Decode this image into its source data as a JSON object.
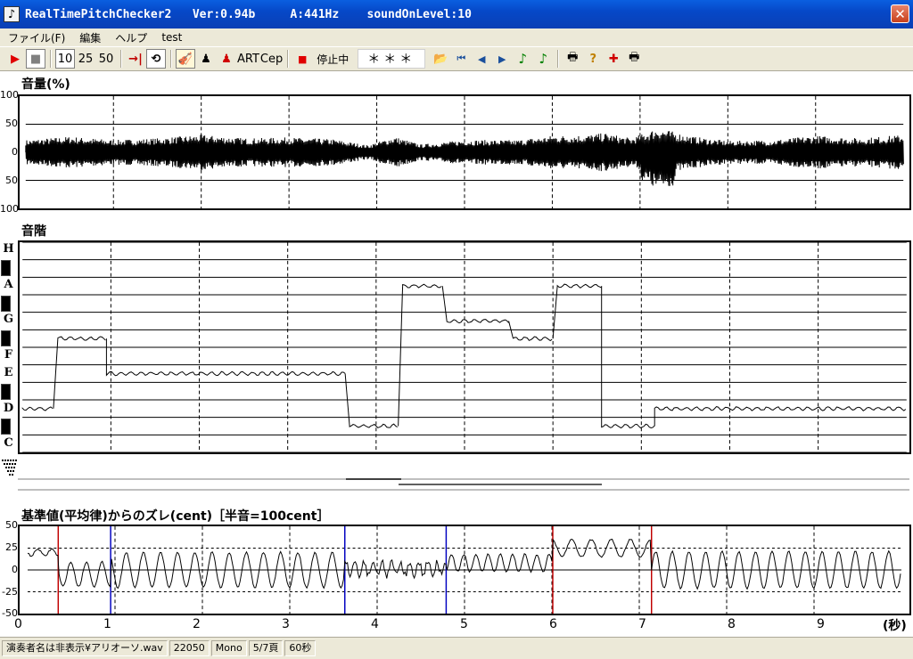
{
  "window": {
    "title": "RealTimePitchChecker2   Ver:0.94b     A:441Hz    soundOnLevel:10",
    "close_glyph": "✕",
    "app_icon_glyph": "♪"
  },
  "menu": [
    "ファイル(F)",
    "編集",
    "ヘルプ",
    "test"
  ],
  "toolbar": {
    "play_glyph": "▶",
    "stop_glyph": "■",
    "n10": "10",
    "n25": "25",
    "n50": "50",
    "to_end_glyph": "→|",
    "loop_glyph": "⟲",
    "violin_glyph": "🎻",
    "person_glyph": "♟",
    "person2_glyph": "♟",
    "art_label": "ART",
    "cep_label": "Cep",
    "rec_glyph": "■",
    "status_label": "停止中",
    "stars": "＊＊＊",
    "open_glyph": "📂",
    "first_glyph": "⏮",
    "prev_glyph": "◀",
    "next_glyph": "▶",
    "note1_glyph": "♪",
    "note2_glyph": "♪",
    "print_glyph": "🖶",
    "help_glyph": "?",
    "cross_glyph": "✚",
    "print2_glyph": "🖶",
    "colors": {
      "play": "#e00000",
      "note_green": "#008000",
      "rec": "#e00000"
    }
  },
  "volume_panel": {
    "title": "音量(%)",
    "y_labels": [
      "100",
      "50",
      "0",
      "50",
      "100"
    ]
  },
  "scale_panel": {
    "title": "音階",
    "notes": [
      "H",
      "A",
      "G",
      "F",
      "E",
      "D",
      "C"
    ]
  },
  "cent_panel": {
    "title": "基準値(平均律)からのズレ(cent)［半音=100cent］",
    "y_labels": [
      "50",
      "25",
      "0",
      "-25",
      "-50"
    ]
  },
  "x_axis": {
    "ticks": [
      "0",
      "1",
      "2",
      "3",
      "4",
      "5",
      "6",
      "7",
      "8",
      "9"
    ],
    "unit": "(秒)"
  },
  "chart_data": {
    "type": "line",
    "x_unit": "seconds",
    "xlim": [
      0,
      10
    ],
    "pitch_track": [
      {
        "x": [
          0.0,
          0.35
        ],
        "note": "D",
        "offset": 0.0
      },
      {
        "x": [
          0.4,
          0.95
        ],
        "note": "F#",
        "offset": 0.0
      },
      {
        "x": [
          0.95,
          3.65
        ],
        "note": "E",
        "offset": 0.0
      },
      {
        "x": [
          3.7,
          4.25
        ],
        "note": "C#",
        "offset": 0.0
      },
      {
        "x": [
          4.3,
          4.75
        ],
        "note": "A",
        "offset": 0.0
      },
      {
        "x": [
          4.8,
          5.5
        ],
        "note": "G",
        "offset": 0.0
      },
      {
        "x": [
          5.55,
          6.0
        ],
        "note": "F#",
        "offset": 0.0
      },
      {
        "x": [
          6.05,
          6.55
        ],
        "note": "A",
        "offset": 0.0
      },
      {
        "x": [
          6.55,
          7.15
        ],
        "note": "C#",
        "offset": 0.0
      },
      {
        "x": [
          7.15,
          10.0
        ],
        "note": "D",
        "offset": 0.0
      }
    ],
    "volume_ylim": [
      -100,
      100
    ],
    "cent_ylim": [
      -50,
      50
    ]
  },
  "status": {
    "file": "演奏者名は非表示¥アリオーソ.wav",
    "rate": "22050",
    "channels": "Mono",
    "page": "5/7頁",
    "duration": "60秒"
  }
}
